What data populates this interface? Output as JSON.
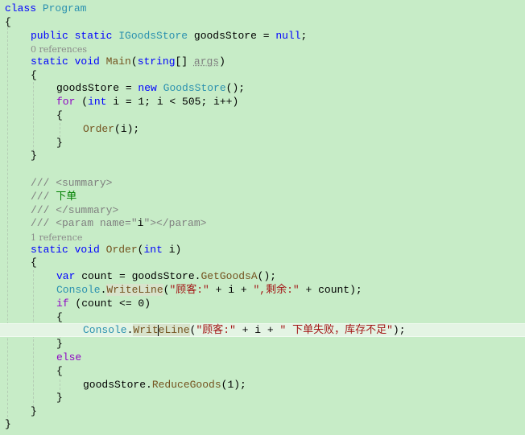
{
  "editor": {
    "background": "#c7ecc7",
    "lines": {
      "l1": {
        "kw": "class",
        "typ": "Program"
      },
      "l2": {
        "brace": "{"
      },
      "l3": {
        "kw1": "public",
        "kw2": "static",
        "typ": "IGoodsStore",
        "name": "goodsStore",
        "eq": " = ",
        "kw3": "null",
        "end": ";"
      },
      "l4": {
        "lens": "0 references"
      },
      "l5": {
        "kw1": "static",
        "kw2": "void",
        "mth": "Main",
        "p1": "(",
        "kw3": "string",
        "p2": "[] ",
        "arg": "args",
        "p3": ")"
      },
      "l6": {
        "brace": "{"
      },
      "l7": {
        "id": "goodsStore",
        "eq": " = ",
        "kw": "new",
        "typ": "GoodsStore",
        "end": "();"
      },
      "l8": {
        "ctl": "for",
        "p1": " (",
        "kw": "int",
        "rest1": " i = 1; i < 505; i++)"
      },
      "l9": {
        "brace": "{"
      },
      "l10": {
        "mth": "Order",
        "rest": "(i);"
      },
      "l11": {
        "brace": "}"
      },
      "l12": {
        "brace": "}"
      },
      "l13": {},
      "l14": {
        "slashes": "///",
        "text": " <summary>"
      },
      "l15": {
        "slashes": "///",
        "text": " 下单"
      },
      "l16": {
        "slashes": "///",
        "text": " </summary>"
      },
      "l17": {
        "slashes": "///",
        "text1": " <param name=\"",
        "pname": "i",
        "text2": "\"></param>"
      },
      "l18": {
        "lens": "1 reference"
      },
      "l19": {
        "kw1": "static",
        "kw2": "void",
        "mth": "Order",
        "p1": "(",
        "kw3": "int",
        "rest": " i)"
      },
      "l20": {
        "brace": "{"
      },
      "l21": {
        "kw": "var",
        "rest1": " count = goodsStore.",
        "mth": "GetGoodsA",
        "rest2": "();"
      },
      "l22": {
        "typ": "Console",
        "dot": ".",
        "mth": "WriteLine",
        "p1": "(",
        "s1": "\"顾客:\"",
        "mid1": " + i + ",
        "s2": "\",剩余:\"",
        "mid2": " + count);"
      },
      "l23": {
        "ctl": "if",
        "rest": " (count <= 0)"
      },
      "l24": {
        "brace": "{"
      },
      "l25": {
        "typ": "Console",
        "dot": ".",
        "mth_a": "Writ",
        "mth_b": "eLine",
        "p1": "(",
        "s1": "\"顾客:\"",
        "mid1": " + i + ",
        "s2": "\" 下单失败，库存不足\"",
        "end": ");"
      },
      "l26": {
        "brace": "}"
      },
      "l27": {
        "ctl": "else"
      },
      "l28": {
        "brace": "{"
      },
      "l29": {
        "id": "goodsStore.",
        "mth": "ReduceGoods",
        "rest": "(1);"
      },
      "l30": {
        "brace": "}"
      },
      "l31": {
        "brace": "}"
      },
      "l32": {
        "brace": "}"
      }
    }
  }
}
